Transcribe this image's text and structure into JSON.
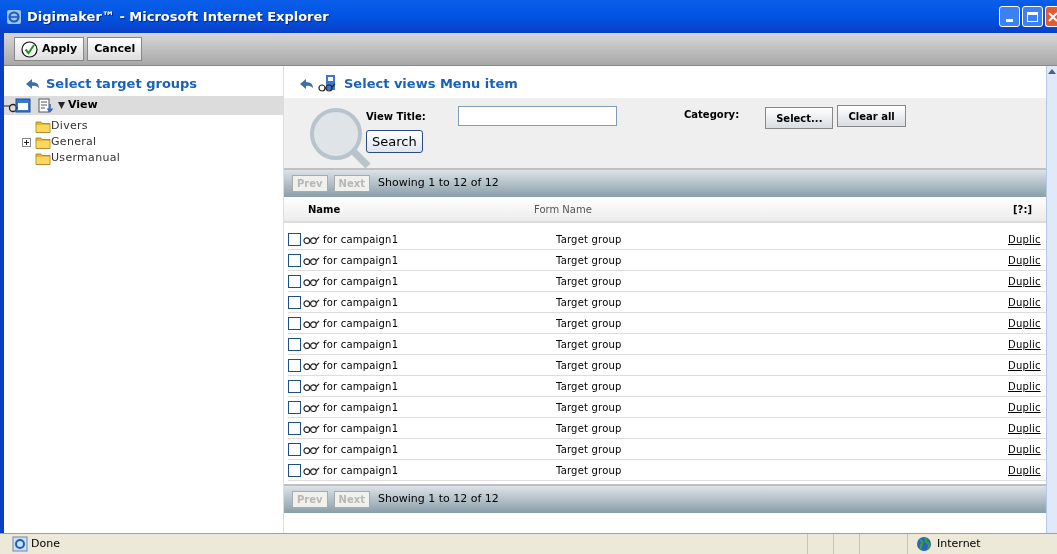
{
  "window": {
    "title": "Digimaker™ - Microsoft Internet Explorer"
  },
  "toolbar": {
    "buttons": [
      {
        "label": "Apply",
        "kind": "check"
      },
      {
        "label": "Cancel",
        "kind": "plain"
      }
    ]
  },
  "left_panel": {
    "title": "Select target groups",
    "tree_header": "View",
    "items": [
      {
        "label": "Divers",
        "kind": "leaf"
      },
      {
        "label": "General",
        "kind": "collapsed"
      },
      {
        "label": "Usermanual",
        "kind": "leaf"
      }
    ]
  },
  "right_panel": {
    "title": "Select views Menu item",
    "search": {
      "view_title_label": "View Title:",
      "search_button": "Search",
      "category_label": "Category:",
      "select_button": "Select...",
      "clear_button": "Clear all"
    },
    "pager_top": {
      "prev": "Prev",
      "next": "Next",
      "text": "Showing 1 to 12 of 12"
    },
    "table": {
      "columns": [
        "Name",
        "Form Name",
        "[?:]"
      ],
      "rows": [
        {
          "name": "for campaign1",
          "form_name": "Target group",
          "action": "Duplic",
          "checked": false
        },
        {
          "name": "for campaign1",
          "form_name": "Target group",
          "action": "Duplic",
          "checked": false
        },
        {
          "name": "for campaign1",
          "form_name": "Target group",
          "action": "Duplic",
          "checked": false
        },
        {
          "name": "for campaign1",
          "form_name": "Target group",
          "action": "Duplic",
          "checked": false
        },
        {
          "name": "for campaign1",
          "form_name": "Target group",
          "action": "Duplic",
          "checked": false
        },
        {
          "name": "for campaign1",
          "form_name": "Target group",
          "action": "Duplic",
          "checked": false
        },
        {
          "name": "for campaign1",
          "form_name": "Target group",
          "action": "Duplic",
          "checked": false
        },
        {
          "name": "for campaign1",
          "form_name": "Target group",
          "action": "Duplic",
          "checked": false
        },
        {
          "name": "for campaign1",
          "form_name": "Target group",
          "action": "Duplic",
          "checked": false
        },
        {
          "name": "for campaign1",
          "form_name": "Target group",
          "action": "Duplic",
          "checked": false
        },
        {
          "name": "for campaign1",
          "form_name": "Target group",
          "action": "Duplic",
          "checked": false
        },
        {
          "name": "for campaign1",
          "form_name": "Target group",
          "action": "Duplic",
          "checked": false
        }
      ]
    },
    "pager_bottom": {
      "prev": "Prev",
      "next": "Next",
      "text": "Showing 1 to 12 of 12"
    }
  },
  "status_bar": {
    "status": "Done",
    "zone": "Internet"
  }
}
